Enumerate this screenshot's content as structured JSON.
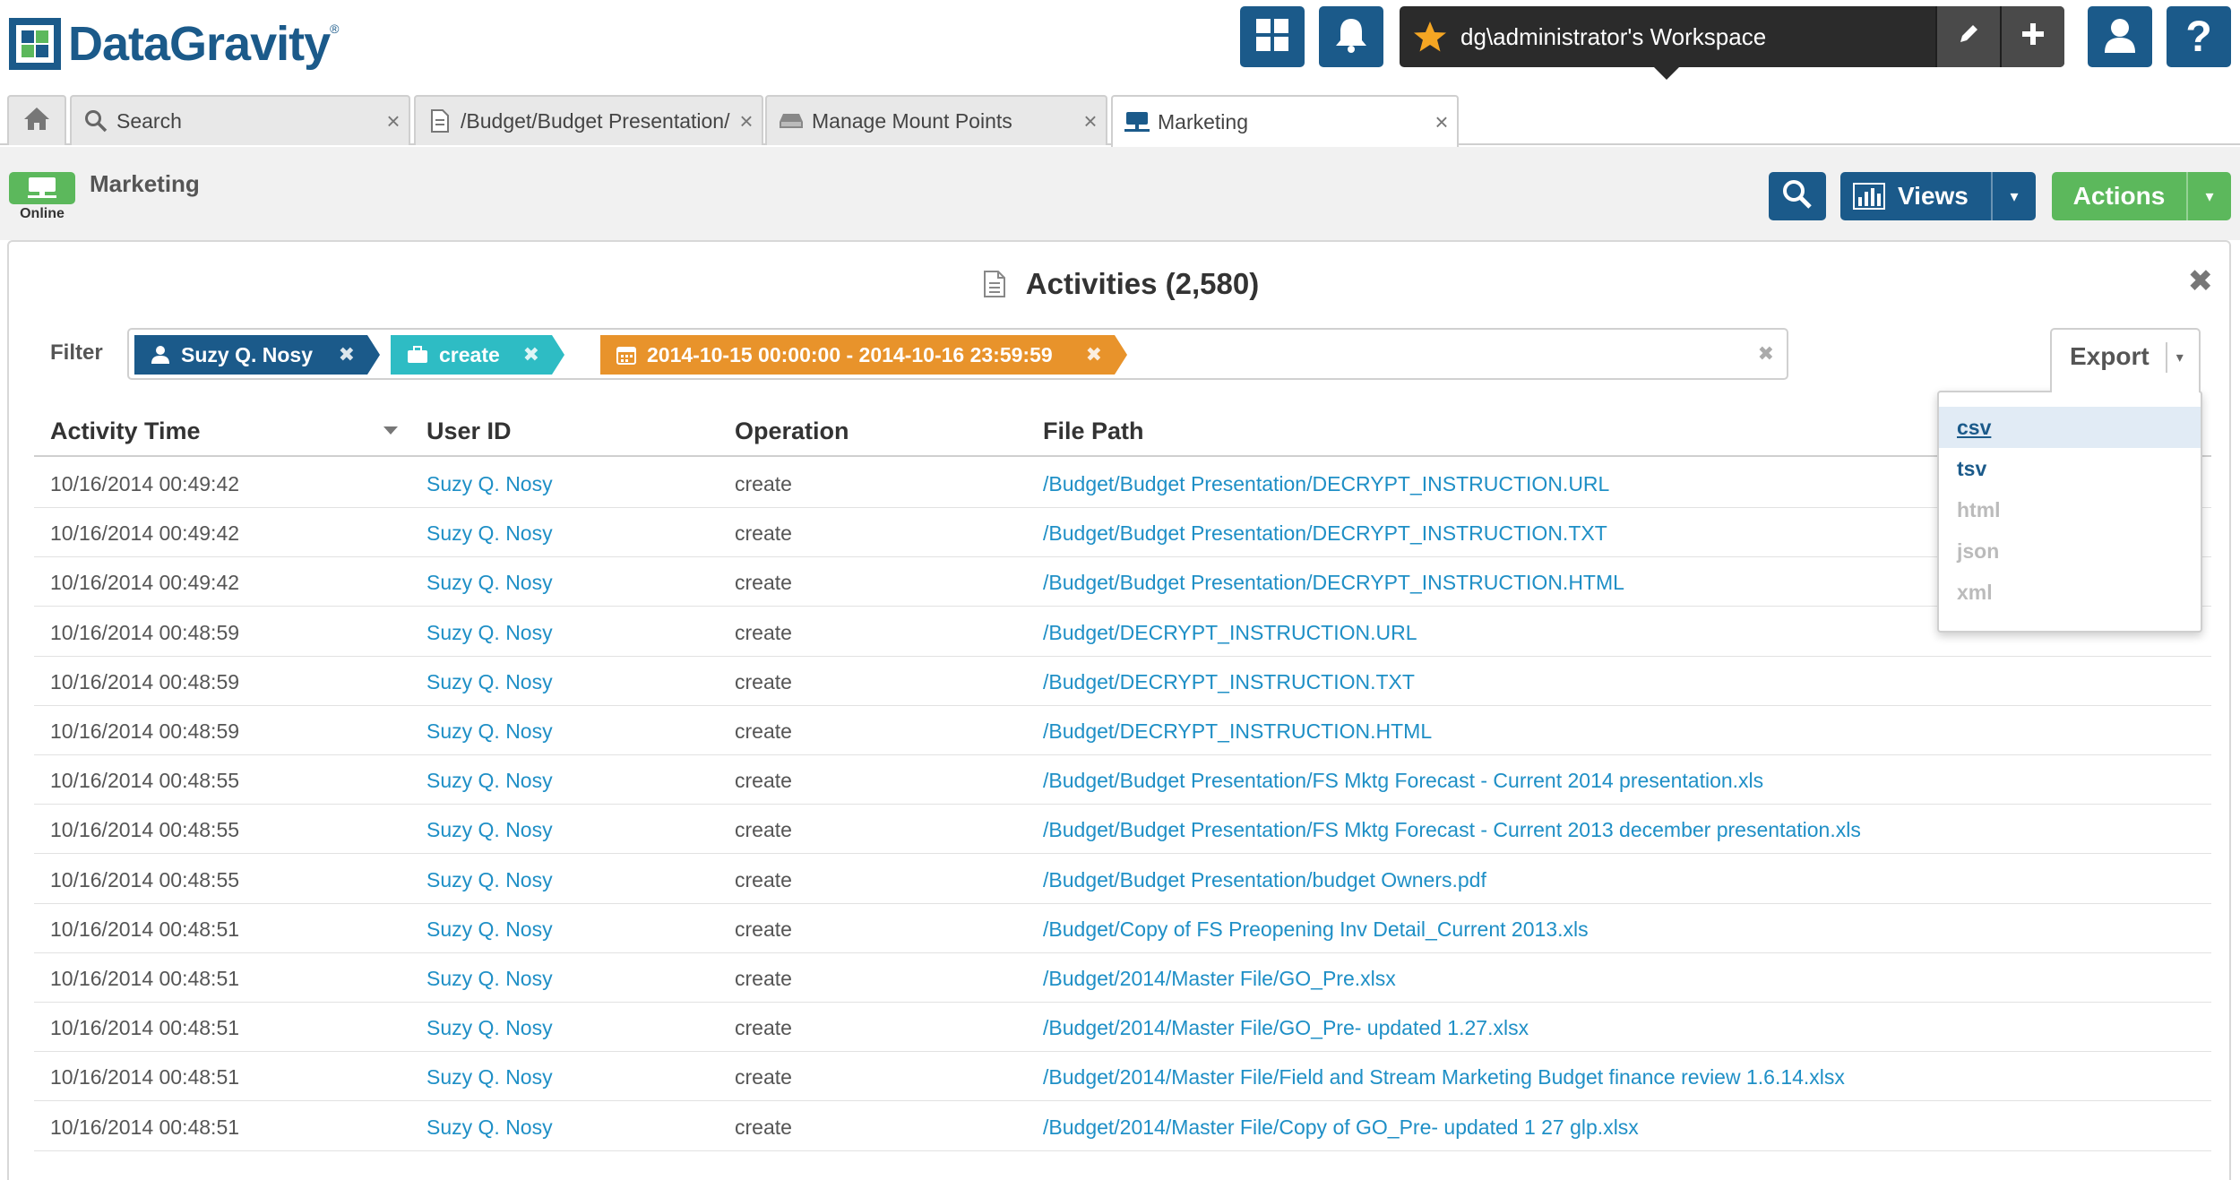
{
  "app": {
    "logo_text": "DataGravity",
    "logo_tm": "®",
    "brand_color": "#1b5a8a",
    "accent_green": "#5cb85c",
    "link_color": "#1e8fc6"
  },
  "header": {
    "icons": [
      "dashboard-grid-icon",
      "bell-icon",
      "star-icon",
      "pencil-icon",
      "plus-icon",
      "user-icon",
      "help-icon"
    ],
    "workspace_label": "dg\\administrator's Workspace",
    "help_glyph": "?"
  },
  "tabs": [
    {
      "label": "",
      "icon": "home-icon"
    },
    {
      "label": "Search",
      "icon": "magnifier-icon",
      "close": "×"
    },
    {
      "label": "/Budget/Budget Presentation/I",
      "icon": "document-icon",
      "close": "×"
    },
    {
      "label": "Manage Mount Points",
      "icon": "drive-icon",
      "close": "×"
    },
    {
      "label": "Marketing",
      "icon": "share-icon",
      "close": "×",
      "active": true
    }
  ],
  "subheader": {
    "share_name": "Marketing",
    "status": "Online",
    "views_label": "Views",
    "actions_label": "Actions",
    "caret": "▾"
  },
  "panel": {
    "title": "Activities (2,580)",
    "close": "✖",
    "filter_label": "Filter",
    "filter_clear": "✖",
    "filters": [
      {
        "text": "Suzy Q. Nosy",
        "icon": "user-icon",
        "color": "#1b5a8a",
        "remove": "✖"
      },
      {
        "text": "create",
        "icon": "briefcase-icon",
        "color": "#2ebcc4",
        "remove": "✖"
      },
      {
        "text": "2014-10-15 00:00:00 - 2014-10-16 23:59:59",
        "icon": "calendar-icon",
        "color": "#e8932b",
        "remove": "✖"
      }
    ],
    "export": {
      "label": "Export",
      "caret": "▾",
      "options": [
        {
          "label": "csv",
          "state": "highlighted"
        },
        {
          "label": "tsv",
          "state": "enabled"
        },
        {
          "label": "html",
          "state": "disabled"
        },
        {
          "label": "json",
          "state": "disabled"
        },
        {
          "label": "xml",
          "state": "disabled"
        }
      ]
    }
  },
  "table": {
    "columns": [
      "Activity Time",
      "User ID",
      "Operation",
      "File Path"
    ],
    "rows": [
      {
        "time": "10/16/2014 00:49:42",
        "user": "Suzy Q. Nosy",
        "op": "create",
        "path": "/Budget/Budget Presentation/DECRYPT_INSTRUCTION.URL"
      },
      {
        "time": "10/16/2014 00:49:42",
        "user": "Suzy Q. Nosy",
        "op": "create",
        "path": "/Budget/Budget Presentation/DECRYPT_INSTRUCTION.TXT"
      },
      {
        "time": "10/16/2014 00:49:42",
        "user": "Suzy Q. Nosy",
        "op": "create",
        "path": "/Budget/Budget Presentation/DECRYPT_INSTRUCTION.HTML"
      },
      {
        "time": "10/16/2014 00:48:59",
        "user": "Suzy Q. Nosy",
        "op": "create",
        "path": "/Budget/DECRYPT_INSTRUCTION.URL"
      },
      {
        "time": "10/16/2014 00:48:59",
        "user": "Suzy Q. Nosy",
        "op": "create",
        "path": "/Budget/DECRYPT_INSTRUCTION.TXT"
      },
      {
        "time": "10/16/2014 00:48:59",
        "user": "Suzy Q. Nosy",
        "op": "create",
        "path": "/Budget/DECRYPT_INSTRUCTION.HTML"
      },
      {
        "time": "10/16/2014 00:48:55",
        "user": "Suzy Q. Nosy",
        "op": "create",
        "path": "/Budget/Budget Presentation/FS Mktg Forecast - Current 2014 presentation.xls"
      },
      {
        "time": "10/16/2014 00:48:55",
        "user": "Suzy Q. Nosy",
        "op": "create",
        "path": "/Budget/Budget Presentation/FS Mktg Forecast - Current 2013 december presentation.xls"
      },
      {
        "time": "10/16/2014 00:48:55",
        "user": "Suzy Q. Nosy",
        "op": "create",
        "path": "/Budget/Budget Presentation/budget Owners.pdf"
      },
      {
        "time": "10/16/2014 00:48:51",
        "user": "Suzy Q. Nosy",
        "op": "create",
        "path": "/Budget/Copy of FS Preopening Inv Detail_Current 2013.xls"
      },
      {
        "time": "10/16/2014 00:48:51",
        "user": "Suzy Q. Nosy",
        "op": "create",
        "path": "/Budget/2014/Master File/GO_Pre.xlsx"
      },
      {
        "time": "10/16/2014 00:48:51",
        "user": "Suzy Q. Nosy",
        "op": "create",
        "path": "/Budget/2014/Master File/GO_Pre- updated 1.27.xlsx"
      },
      {
        "time": "10/16/2014 00:48:51",
        "user": "Suzy Q. Nosy",
        "op": "create",
        "path": "/Budget/2014/Master File/Field and Stream Marketing Budget finance review 1.6.14.xlsx"
      },
      {
        "time": "10/16/2014 00:48:51",
        "user": "Suzy Q. Nosy",
        "op": "create",
        "path": "/Budget/2014/Master File/Copy of GO_Pre- updated 1 27 glp.xlsx"
      }
    ]
  }
}
